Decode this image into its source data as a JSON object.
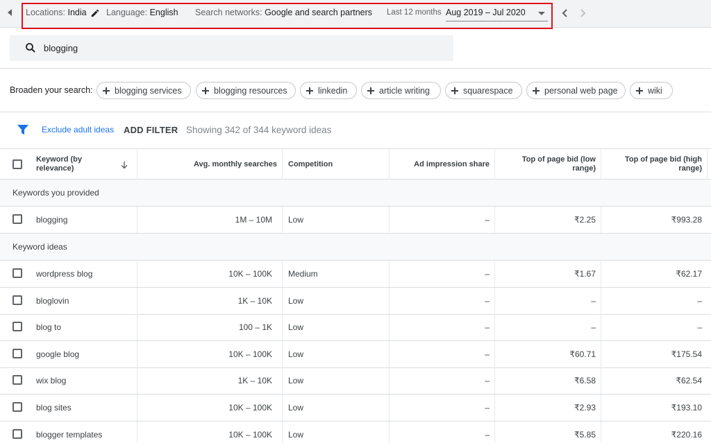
{
  "topbar": {
    "location_label": "Locations:",
    "location_value": "India",
    "language_label": "Language:",
    "language_value": "English",
    "networks_label": "Search networks:",
    "networks_value": "Google and search partners",
    "range_label": "Last 12 months",
    "range_value": "Aug 2019 – Jul 2020",
    "highlight_color": "#e0141e"
  },
  "search": {
    "query": "blogging"
  },
  "broaden": {
    "label": "Broaden your search:",
    "chips": [
      "blogging services",
      "blogging resources",
      "linkedin",
      "article writing",
      "squarespace",
      "personal web page",
      "wiki"
    ]
  },
  "filters": {
    "exclude_label": "Exclude adult ideas",
    "add_filter_label": "ADD FILTER",
    "showing_text": "Showing 342 of 344 keyword ideas",
    "accent_color": "#1a73e8"
  },
  "table": {
    "headers": {
      "keyword_line1": "Keyword (by",
      "keyword_line2": "relevance)",
      "avg_searches": "Avg. monthly searches",
      "competition": "Competition",
      "ad_share": "Ad impression share",
      "bid_low_line1": "Top of page bid (low",
      "bid_low_line2": "range)",
      "bid_high_line1": "Top of page bid (high",
      "bid_high_line2": "range)"
    },
    "group_provided": "Keywords you provided",
    "provided_rows": [
      {
        "keyword": "blogging",
        "avg": "1M – 10M",
        "competition": "Low",
        "ad_share": "–",
        "bid_low": "₹2.25",
        "bid_high": "₹993.28"
      }
    ],
    "group_ideas": "Keyword ideas",
    "idea_rows": [
      {
        "keyword": "wordpress blog",
        "avg": "10K – 100K",
        "competition": "Medium",
        "ad_share": "–",
        "bid_low": "₹1.67",
        "bid_high": "₹62.17"
      },
      {
        "keyword": "bloglovin",
        "avg": "1K – 10K",
        "competition": "Low",
        "ad_share": "–",
        "bid_low": "–",
        "bid_high": "–"
      },
      {
        "keyword": "blog to",
        "avg": "100 – 1K",
        "competition": "Low",
        "ad_share": "–",
        "bid_low": "–",
        "bid_high": "–"
      },
      {
        "keyword": "google blog",
        "avg": "10K – 100K",
        "competition": "Low",
        "ad_share": "–",
        "bid_low": "₹60.71",
        "bid_high": "₹175.54"
      },
      {
        "keyword": "wix blog",
        "avg": "1K – 10K",
        "competition": "Low",
        "ad_share": "–",
        "bid_low": "₹6.58",
        "bid_high": "₹62.54"
      },
      {
        "keyword": "blog sites",
        "avg": "10K – 100K",
        "competition": "Low",
        "ad_share": "–",
        "bid_low": "₹2.93",
        "bid_high": "₹193.10"
      },
      {
        "keyword": "blogger templates",
        "avg": "10K – 100K",
        "competition": "Low",
        "ad_share": "–",
        "bid_low": "₹5.85",
        "bid_high": "₹220.16"
      }
    ]
  }
}
